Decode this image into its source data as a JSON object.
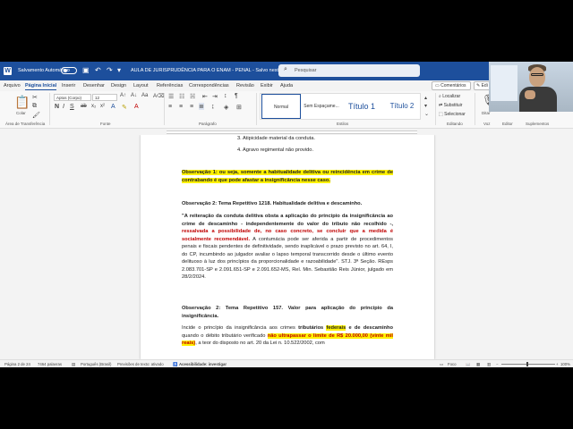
{
  "titlebar": {
    "autosave_label": "Salvamento Automático",
    "document_title": "AULA DE JURISPRUDÊNCIA PARA O ENAM - PENAL - Salvo neste PC",
    "search_placeholder": "Pesquisar"
  },
  "tabs": [
    {
      "label": "Arquivo"
    },
    {
      "label": "Página Inicial"
    },
    {
      "label": "Inserir"
    },
    {
      "label": "Desenhar"
    },
    {
      "label": "Design"
    },
    {
      "label": "Layout"
    },
    {
      "label": "Referências"
    },
    {
      "label": "Correspondências"
    },
    {
      "label": "Revisão"
    },
    {
      "label": "Exibir"
    },
    {
      "label": "Ajuda"
    }
  ],
  "actions": {
    "comments": "Comentários",
    "edit": "Edi"
  },
  "ribbon": {
    "paste": "Colar",
    "clipboard_group": "Área de Transferência",
    "font_name": "Aptos (Corpo)",
    "font_size": "12",
    "font_group": "Fonte",
    "paragraph_group": "Parágrafo",
    "styles": [
      "Normal",
      "Sem Espaçame...",
      "Título 1",
      "Título 2"
    ],
    "styles_group": "Estilos",
    "find": "Localizar",
    "replace": "Substituir",
    "select": "Selecionar",
    "editing_group": "Editando",
    "voice": "Ditar",
    "voice_group": "Voz",
    "editor_group": "Editor",
    "addins_group": "Suplementos"
  },
  "document": {
    "list_item_3": "3. Atipicidade material da conduta.",
    "list_item_4": "4. Agravo regimental não provido.",
    "obs1": "Observação 1: ou seja, somente a habitualidade delitiva ou reincidência em crime de contrabando é que pode afastar a insignificância nesse caso.",
    "obs2_title": "Observação 2: Tema Repetitivo 1218. Habitualidade delitiva e descaminho.",
    "quote_bold": "\"A reiteração da conduta delitiva obsta a aplicação do princípio da insignificância ao crime de descaminho - independentemente do valor do tributo não recolhido -,",
    "quote_red": "ressalvada a possibilidade de, no caso concreto, se concluir que a medida é socialmente recomendável.",
    "quote_rest": "A contumácia pode ser aferida a partir de procedimentos penais e fiscais pendentes de definitividade, sendo inaplicável o prazo previsto no art. 64, I, do CP, incumbindo ao julgador avaliar o lapso temporal transcorrido desde o último evento delituoso à luz dos princípios da proporcionalidade e razoabilidade\". STJ. 3ª Seção.",
    "quote_ref": "REsps 2.083.701-SP e 2.091.651-SP e 2.091.652-MS, Rel. Min. Sebastião Reis Júnior, julgado em 28/2/2024.",
    "obs3_title": "Observação 2: Tema Repetitivo 157. Valor para aplicação do princípio da insignificância.",
    "p_start": "Incide o princípio da insignificância aos crimes",
    "p_tributarios": "tributários",
    "p_federais": "federais",
    "p_e_de": "e de",
    "p_descaminho": "descaminho",
    "p_quando": "quando o débito tributário verificado",
    "p_nao_ultrapassar": "não ultrapassar o limite de R$ 20.000,00 (vinte mil reais)",
    "p_end": ", a teor do disposto no art. 20 da Lei n. 10.522/2002, com"
  },
  "status": {
    "page": "Página 2 de 24",
    "words": "7464 palavras",
    "language": "Português (Brasil)",
    "predictions": "Previsões de texto: ativado",
    "accessibility": "Acessibilidade: investigar",
    "focus": "Foco",
    "zoom": "100%"
  },
  "colors": {
    "accent": "#1d4f9c",
    "highlight": "#fff200",
    "red_text": "#c00000"
  }
}
